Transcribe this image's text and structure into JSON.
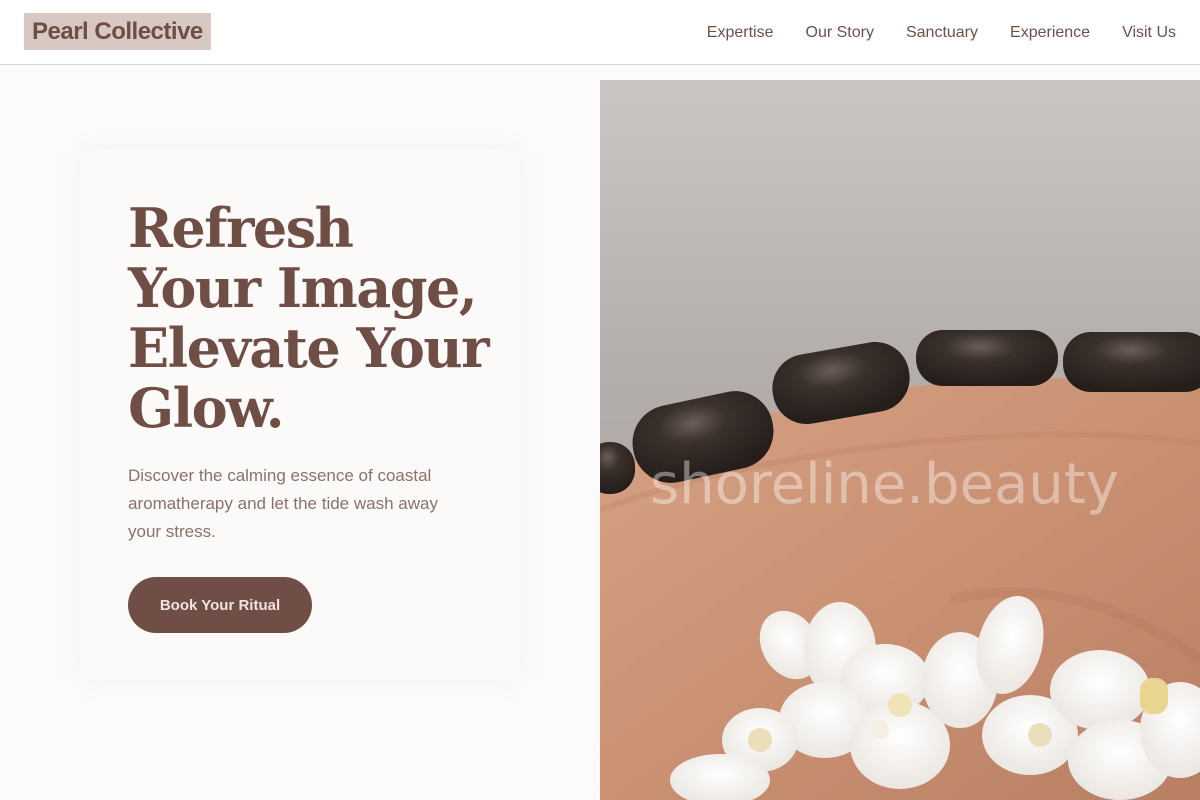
{
  "header": {
    "logo": "Pearl Collective",
    "nav": [
      "Expertise",
      "Our Story",
      "Sanctuary",
      "Experience",
      "Visit Us"
    ]
  },
  "hero": {
    "title_lines": [
      "Refresh",
      "Your Image,",
      "Elevate Your",
      "Glow."
    ],
    "description": "Discover the calming essence of coastal aromatherapy and let the tide wash away your stress.",
    "cta_label": "Book Your Ritual",
    "image_watermark": "shoreline.beauty",
    "image_subject": "hot-stone-massage-photo"
  },
  "colors": {
    "brand": "#6e4e45",
    "logo_bg": "#d8c8c3",
    "nav_text": "#6e5148",
    "body_text": "#8a726b"
  }
}
